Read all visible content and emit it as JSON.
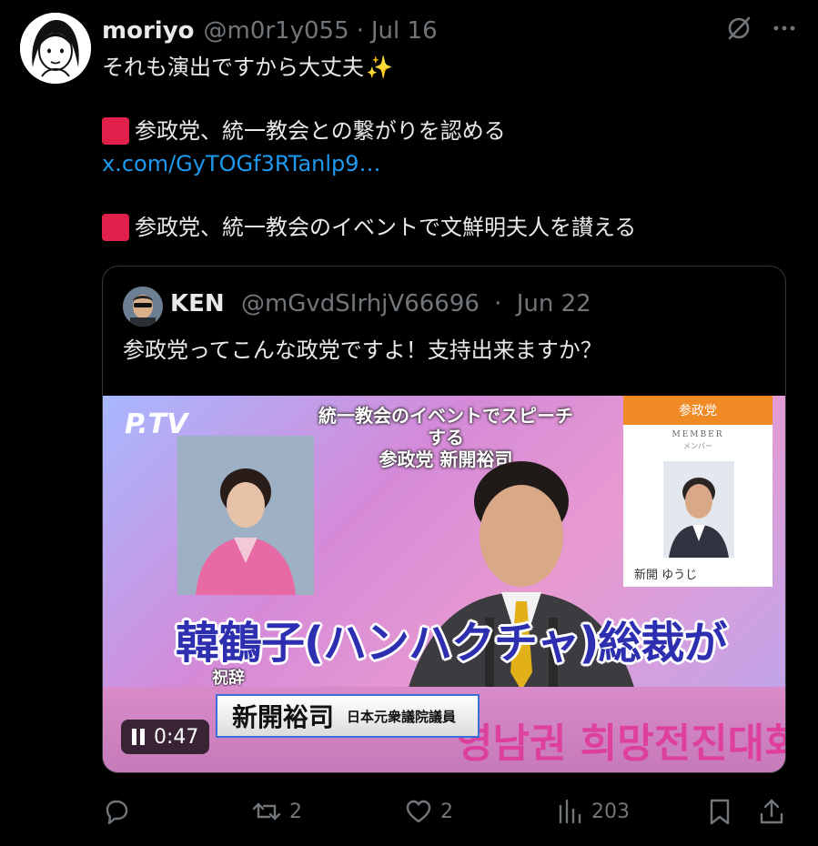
{
  "post": {
    "display_name": "moriyo",
    "handle": "@m0r1y055",
    "separator": "·",
    "date": "Jul 16",
    "lines": {
      "l1": "それも演出ですから大丈夫",
      "l1_emoji": "✨",
      "l2": "参政党、統一教会との繋がりを認める",
      "link": "x.com/GyTOGf3RTanlp9…",
      "l3": "参政党、統一教会のイベントで文鮮明夫人を讃える"
    }
  },
  "quote": {
    "display_name": "KEN",
    "handle": "@mGvdSIrhjV66696",
    "separator": "·",
    "date": "Jun 22",
    "text": "参政党ってこんな政党ですよ！支持出来ますか？",
    "video": {
      "channel_logo": "P.TV",
      "caption_top_1": "統一教会のイベントでスピーチする",
      "caption_top_2": "参政党 新開裕司",
      "card_party": "参政党",
      "card_member": "MEMBER",
      "card_member_sub": "メンバー",
      "card_name": "新開 ゆうじ",
      "big_caption": "韓鶴子(ハンハクチャ)総裁が",
      "shukuji": "祝辞",
      "nameplate_name": "新開裕司",
      "nameplate_title": "日本元衆議院議員",
      "korean_banner": "영남권 희망전진대회",
      "time": "0:47",
      "state": "playing"
    }
  },
  "actions": {
    "reply_count": "",
    "repost_count": "2",
    "like_count": "2",
    "views_count": "203"
  },
  "icons": {
    "grok": "grok-icon",
    "more": "more-icon",
    "reply": "reply-icon",
    "repost": "repost-icon",
    "like": "heart-icon",
    "views": "views-icon",
    "bookmark": "bookmark-icon",
    "share": "share-icon"
  },
  "colors": {
    "background": "#000000",
    "text": "#e7e9ea",
    "muted": "#71767b",
    "link": "#1d9bf0",
    "red_square": "#e0204a"
  }
}
